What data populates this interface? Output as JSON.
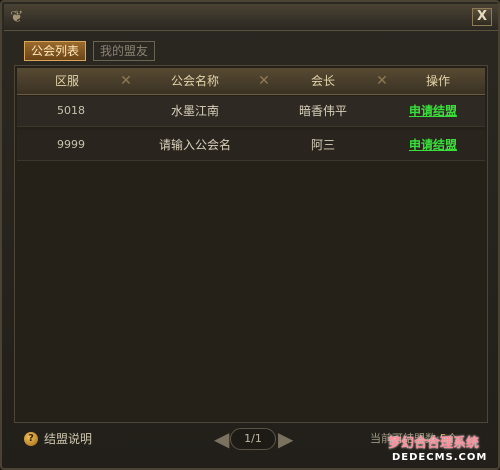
{
  "window": {
    "close_label": "X",
    "ornament_glyph": "❦"
  },
  "tabs": [
    {
      "label": "公会列表",
      "active": true
    },
    {
      "label": "我的盟友",
      "active": false
    }
  ],
  "table": {
    "columns": [
      "区服",
      "公会名称",
      "会长",
      "操作"
    ],
    "rows": [
      {
        "server": "5018",
        "guild": "水墨江南",
        "leader": "暗香伟平",
        "action": "申请结盟"
      },
      {
        "server": "9999",
        "guild": "请输入公会名",
        "leader": "阿三",
        "action": "申请结盟"
      }
    ]
  },
  "footer": {
    "help_icon": "?",
    "help_label": "结盟说明",
    "pager": {
      "prev": "◀",
      "text": "1/1",
      "next": "▶"
    },
    "status_label": "当前可结盟数:",
    "status_value": "5",
    "status_suffix": "个"
  },
  "watermark": {
    "line1": "梦幻合合理系统",
    "line2": "DEDECMS.COM"
  },
  "colors": {
    "accent_gold": "#d9a65a",
    "link_green": "#39e03a",
    "panel_bg": "#252119"
  }
}
